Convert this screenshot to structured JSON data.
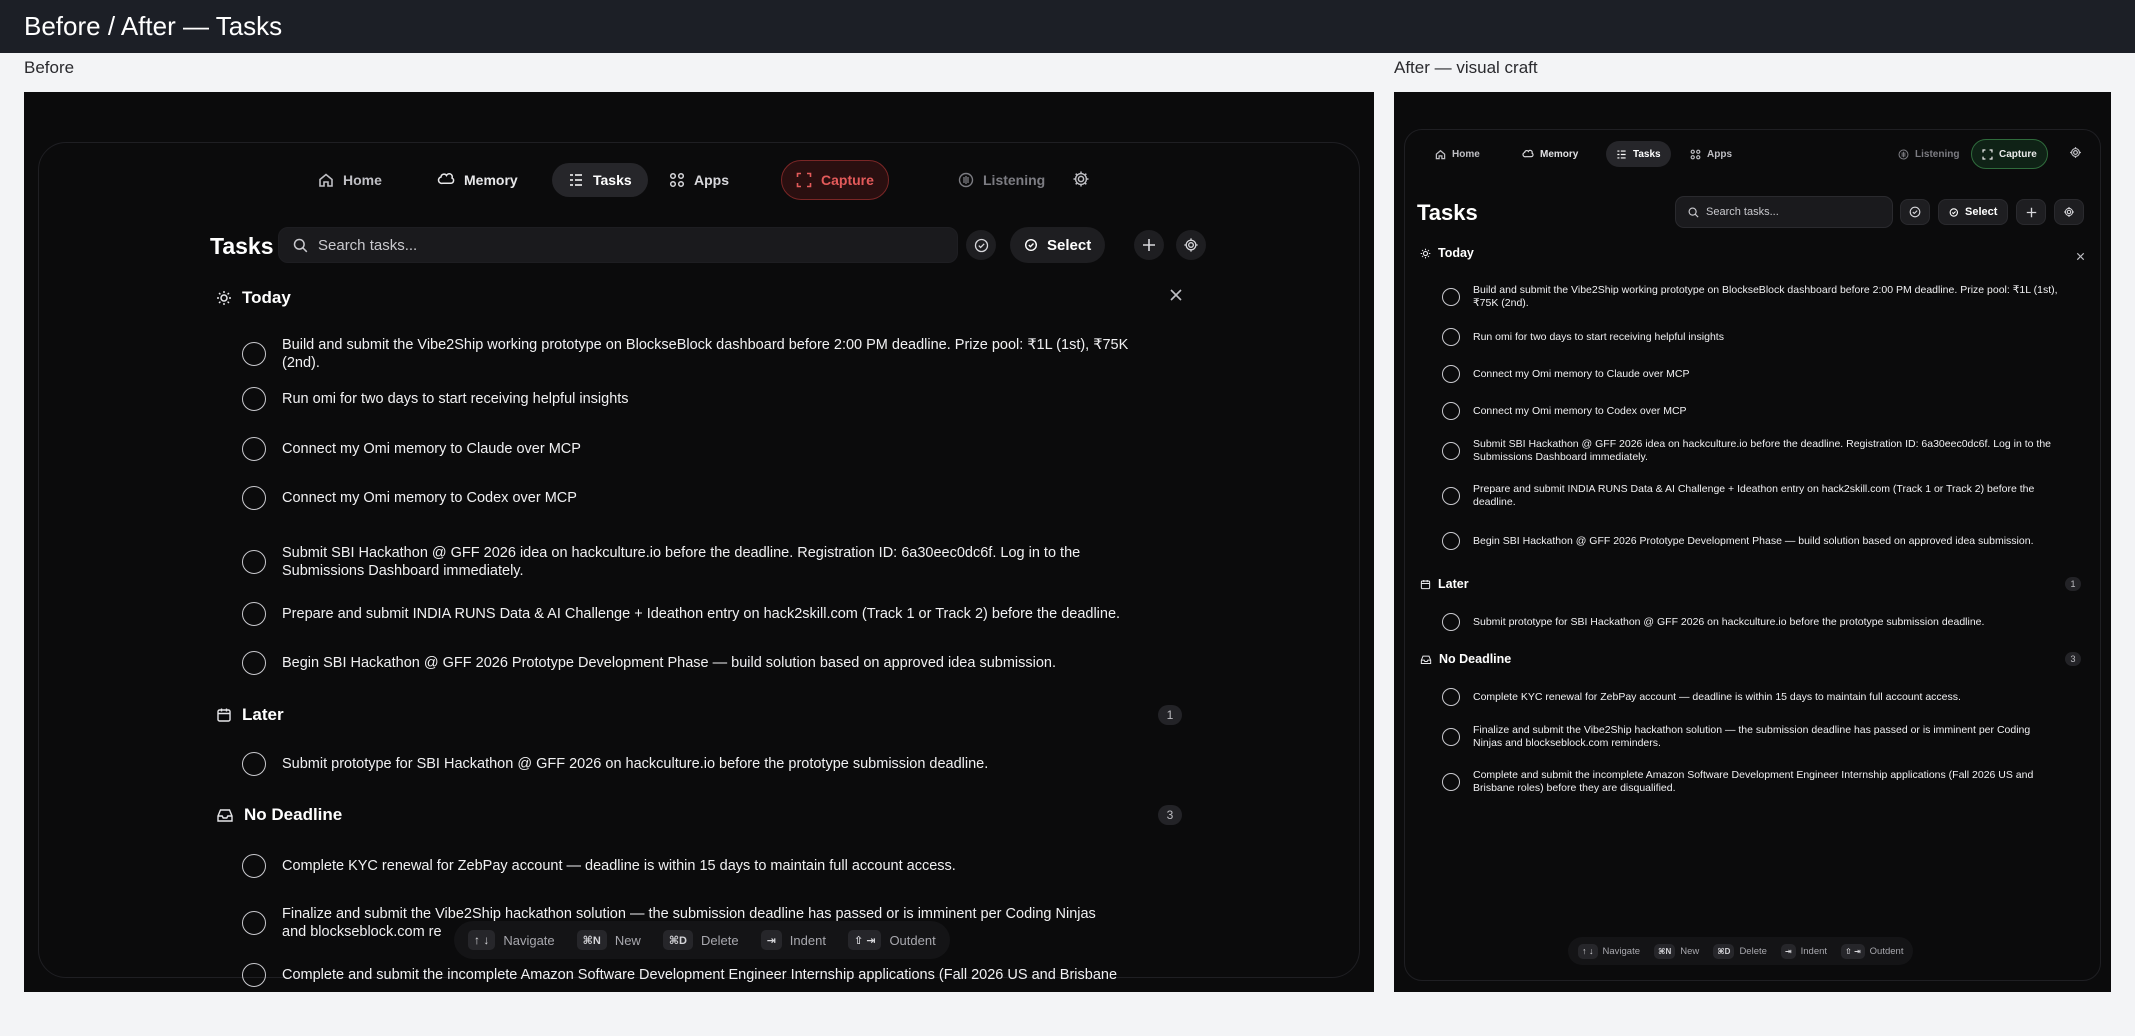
{
  "page": {
    "title": "Before / After — Tasks"
  },
  "before": {
    "caption": "Before"
  },
  "after": {
    "caption": "After — visual craft"
  },
  "nav": {
    "home": "Home",
    "memory": "Memory",
    "tasks": "Tasks",
    "apps": "Apps",
    "capture": "Capture",
    "listening": "Listening"
  },
  "header": {
    "title": "Tasks",
    "search_placeholder": "Search tasks...",
    "select_label": "Select"
  },
  "sections": {
    "today": {
      "label": "Today",
      "tasks": [
        "Build and submit the Vibe2Ship working prototype on BlockseBlock dashboard before 2:00 PM deadline. Prize pool: ₹1L (1st), ₹75K (2nd).",
        "Run omi for two days to start receiving helpful insights",
        "Connect my Omi memory to Claude over MCP",
        "Connect my Omi memory to Codex over MCP",
        "Submit SBI Hackathon @ GFF 2026 idea on hackculture.io before the deadline. Registration ID: 6a30eec0dc6f. Log in to the Submissions Dashboard immediately.",
        "Prepare and submit INDIA RUNS Data & AI Challenge + Ideathon entry on hack2skill.com (Track 1 or Track 2) before the deadline.",
        "Begin SBI Hackathon @ GFF 2026 Prototype Development Phase — build solution based on approved idea submission."
      ]
    },
    "later": {
      "label": "Later",
      "count": "1",
      "tasks": [
        "Submit prototype for SBI Hackathon @ GFF 2026 on hackculture.io before the prototype submission deadline."
      ]
    },
    "no_deadline": {
      "label": "No Deadline",
      "count": "3",
      "tasks": [
        "Complete KYC renewal for ZebPay account — deadline is within 15 days to maintain full account access.",
        "Finalize and submit the Vibe2Ship hackathon solution — the submission deadline has passed or is imminent per Coding Ninjas and blockseblock.com reminders.",
        "Complete and submit the incomplete Amazon Software Development Engineer Internship applications (Fall 2026 US and Brisbane roles) before they are disqualified."
      ]
    }
  },
  "before_clipped": {
    "finalize_line1": "Finalize and submit the Vibe2Ship hackathon solution — the submission deadline has passed or is imminent per Coding Ninjas",
    "finalize_line2": "and blockseblock.com re",
    "amazon_line": "Complete and submit the incomplete Amazon Software Development Engineer Internship applications (Fall 2026 US and Brisbane"
  },
  "shortcuts": {
    "navigate_keys": "↑ ↓",
    "navigate": "Navigate",
    "new_keys": "⌘N",
    "new": "New",
    "delete_keys": "⌘D",
    "delete": "Delete",
    "indent_keys": "⇥",
    "indent": "Indent",
    "outdent_keys": "⇧ ⇥",
    "outdent": "Outdent"
  }
}
